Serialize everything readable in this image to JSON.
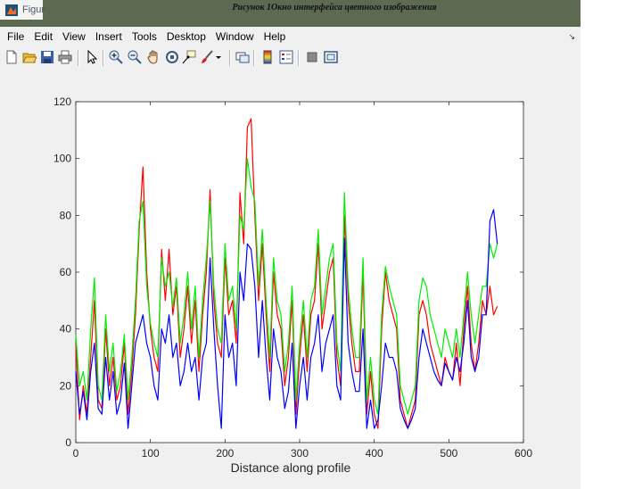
{
  "document": {
    "caption": "Рисунок 1Окно интерфейса цветного изображения"
  },
  "window": {
    "title": "Figur",
    "app_icon": "matlab-icon"
  },
  "menu": {
    "items": [
      "File",
      "Edit",
      "View",
      "Insert",
      "Tools",
      "Desktop",
      "Window",
      "Help"
    ],
    "overflow_icon": "dock-arrow-icon"
  },
  "toolbar": {
    "buttons": [
      "new-figure-icon",
      "open-file-icon",
      "save-icon",
      "print-icon",
      "pointer-icon",
      "zoom-in-icon",
      "zoom-out-icon",
      "pan-icon",
      "rotate-3d-icon",
      "data-cursor-icon",
      "brush-icon",
      "brush-dropdown-icon",
      "link-plot-icon",
      "insert-colorbar-icon",
      "insert-legend-icon",
      "hide-plot-tools-icon",
      "show-plot-tools-icon"
    ]
  },
  "colors": {
    "red": "#ff0000",
    "green": "#00ee00",
    "blue": "#0000ff",
    "titlebar": "#5d6a52"
  },
  "chart_data": {
    "type": "line",
    "title": "",
    "xlabel": "Distance along profile",
    "ylabel": "",
    "xlim": [
      0,
      600
    ],
    "ylim": [
      0,
      120
    ],
    "xticks": [
      0,
      100,
      200,
      300,
      400,
      500,
      600
    ],
    "yticks": [
      0,
      20,
      40,
      60,
      80,
      100,
      120
    ],
    "grid": false,
    "series": [
      {
        "color": "red",
        "x": [
          0,
          5,
          10,
          15,
          20,
          25,
          30,
          35,
          40,
          45,
          50,
          55,
          60,
          65,
          70,
          75,
          80,
          85,
          90,
          95,
          100,
          105,
          110,
          115,
          120,
          125,
          130,
          135,
          140,
          145,
          150,
          155,
          160,
          165,
          170,
          175,
          180,
          185,
          190,
          195,
          200,
          205,
          210,
          215,
          220,
          225,
          230,
          235,
          240,
          245,
          250,
          255,
          260,
          265,
          270,
          275,
          280,
          285,
          290,
          295,
          300,
          305,
          310,
          315,
          320,
          325,
          330,
          335,
          340,
          345,
          350,
          355,
          360,
          365,
          370,
          375,
          380,
          385,
          390,
          395,
          400,
          405,
          410,
          415,
          420,
          425,
          430,
          435,
          440,
          445,
          450,
          455,
          460,
          465,
          470,
          475,
          480,
          485,
          490,
          495,
          500,
          505,
          510,
          515,
          520,
          525,
          530,
          535,
          540,
          545,
          550,
          555,
          560,
          565
        ],
        "values": [
          35,
          8,
          20,
          10,
          30,
          50,
          15,
          12,
          40,
          20,
          30,
          15,
          20,
          35,
          10,
          25,
          45,
          75,
          97,
          60,
          40,
          30,
          25,
          68,
          50,
          68,
          45,
          55,
          30,
          40,
          55,
          35,
          50,
          25,
          45,
          60,
          89,
          50,
          35,
          30,
          65,
          45,
          50,
          35,
          88,
          70,
          111,
          114,
          80,
          50,
          70,
          45,
          25,
          60,
          45,
          40,
          20,
          30,
          50,
          10,
          30,
          45,
          25,
          45,
          50,
          70,
          40,
          50,
          60,
          65,
          30,
          20,
          80,
          50,
          35,
          25,
          25,
          60,
          10,
          25,
          10,
          5,
          40,
          60,
          50,
          45,
          40,
          15,
          10,
          5,
          10,
          15,
          45,
          50,
          45,
          35,
          30,
          25,
          20,
          30,
          25,
          22,
          35,
          20,
          40,
          55,
          35,
          25,
          35,
          50,
          45,
          55,
          45,
          48
        ]
      },
      {
        "color": "green",
        "x": [
          0,
          5,
          10,
          15,
          20,
          25,
          30,
          35,
          40,
          45,
          50,
          55,
          60,
          65,
          70,
          75,
          80,
          85,
          90,
          95,
          100,
          105,
          110,
          115,
          120,
          125,
          130,
          135,
          140,
          145,
          150,
          155,
          160,
          165,
          170,
          175,
          180,
          185,
          190,
          195,
          200,
          205,
          210,
          215,
          220,
          225,
          230,
          235,
          240,
          245,
          250,
          255,
          260,
          265,
          270,
          275,
          280,
          285,
          290,
          295,
          300,
          305,
          310,
          315,
          320,
          325,
          330,
          335,
          340,
          345,
          350,
          355,
          360,
          365,
          370,
          375,
          380,
          385,
          390,
          395,
          400,
          405,
          410,
          415,
          420,
          425,
          430,
          435,
          440,
          445,
          450,
          455,
          460,
          465,
          470,
          475,
          480,
          485,
          490,
          495,
          500,
          505,
          510,
          515,
          520,
          525,
          530,
          535,
          540,
          545,
          550,
          555,
          560,
          565
        ],
        "values": [
          38,
          20,
          25,
          15,
          40,
          58,
          20,
          15,
          45,
          25,
          35,
          18,
          25,
          38,
          15,
          30,
          50,
          78,
          85,
          55,
          42,
          35,
          30,
          65,
          55,
          60,
          48,
          58,
          35,
          45,
          60,
          40,
          55,
          30,
          50,
          65,
          85,
          55,
          40,
          35,
          70,
          50,
          55,
          40,
          80,
          75,
          100,
          90,
          85,
          55,
          75,
          50,
          30,
          65,
          50,
          45,
          25,
          35,
          55,
          15,
          35,
          50,
          30,
          50,
          55,
          75,
          45,
          55,
          65,
          70,
          35,
          25,
          88,
          55,
          40,
          30,
          30,
          65,
          15,
          30,
          15,
          10,
          45,
          62,
          55,
          50,
          45,
          20,
          15,
          10,
          15,
          20,
          50,
          58,
          55,
          45,
          40,
          35,
          30,
          40,
          35,
          30,
          40,
          30,
          45,
          60,
          45,
          35,
          45,
          55,
          55,
          70,
          65,
          70
        ]
      },
      {
        "color": "blue",
        "x": [
          0,
          5,
          10,
          15,
          20,
          25,
          30,
          35,
          40,
          45,
          50,
          55,
          60,
          65,
          70,
          75,
          80,
          85,
          90,
          95,
          100,
          105,
          110,
          115,
          120,
          125,
          130,
          135,
          140,
          145,
          150,
          155,
          160,
          165,
          170,
          175,
          180,
          185,
          190,
          195,
          200,
          205,
          210,
          215,
          220,
          225,
          230,
          235,
          240,
          245,
          250,
          255,
          260,
          265,
          270,
          275,
          280,
          285,
          290,
          295,
          300,
          305,
          310,
          315,
          320,
          325,
          330,
          335,
          340,
          345,
          350,
          355,
          360,
          365,
          370,
          375,
          380,
          385,
          390,
          395,
          400,
          405,
          410,
          415,
          420,
          425,
          430,
          435,
          440,
          445,
          450,
          455,
          460,
          465,
          470,
          475,
          480,
          485,
          490,
          495,
          500,
          505,
          510,
          515,
          520,
          525,
          530,
          535,
          540,
          545,
          550,
          555,
          560,
          565
        ],
        "values": [
          25,
          10,
          18,
          8,
          25,
          35,
          12,
          10,
          30,
          15,
          25,
          10,
          15,
          28,
          5,
          20,
          35,
          40,
          45,
          35,
          30,
          20,
          15,
          40,
          35,
          45,
          30,
          35,
          20,
          25,
          35,
          25,
          30,
          15,
          30,
          35,
          65,
          40,
          20,
          5,
          45,
          30,
          35,
          20,
          60,
          50,
          70,
          68,
          55,
          30,
          50,
          30,
          15,
          40,
          30,
          25,
          12,
          18,
          35,
          5,
          20,
          30,
          15,
          30,
          35,
          45,
          25,
          35,
          40,
          45,
          20,
          15,
          72,
          35,
          25,
          18,
          18,
          40,
          5,
          15,
          5,
          8,
          20,
          35,
          30,
          30,
          25,
          12,
          8,
          5,
          8,
          12,
          30,
          40,
          35,
          30,
          25,
          22,
          20,
          28,
          25,
          22,
          30,
          25,
          35,
          50,
          30,
          25,
          30,
          45,
          45,
          78,
          82,
          70
        ]
      }
    ]
  }
}
